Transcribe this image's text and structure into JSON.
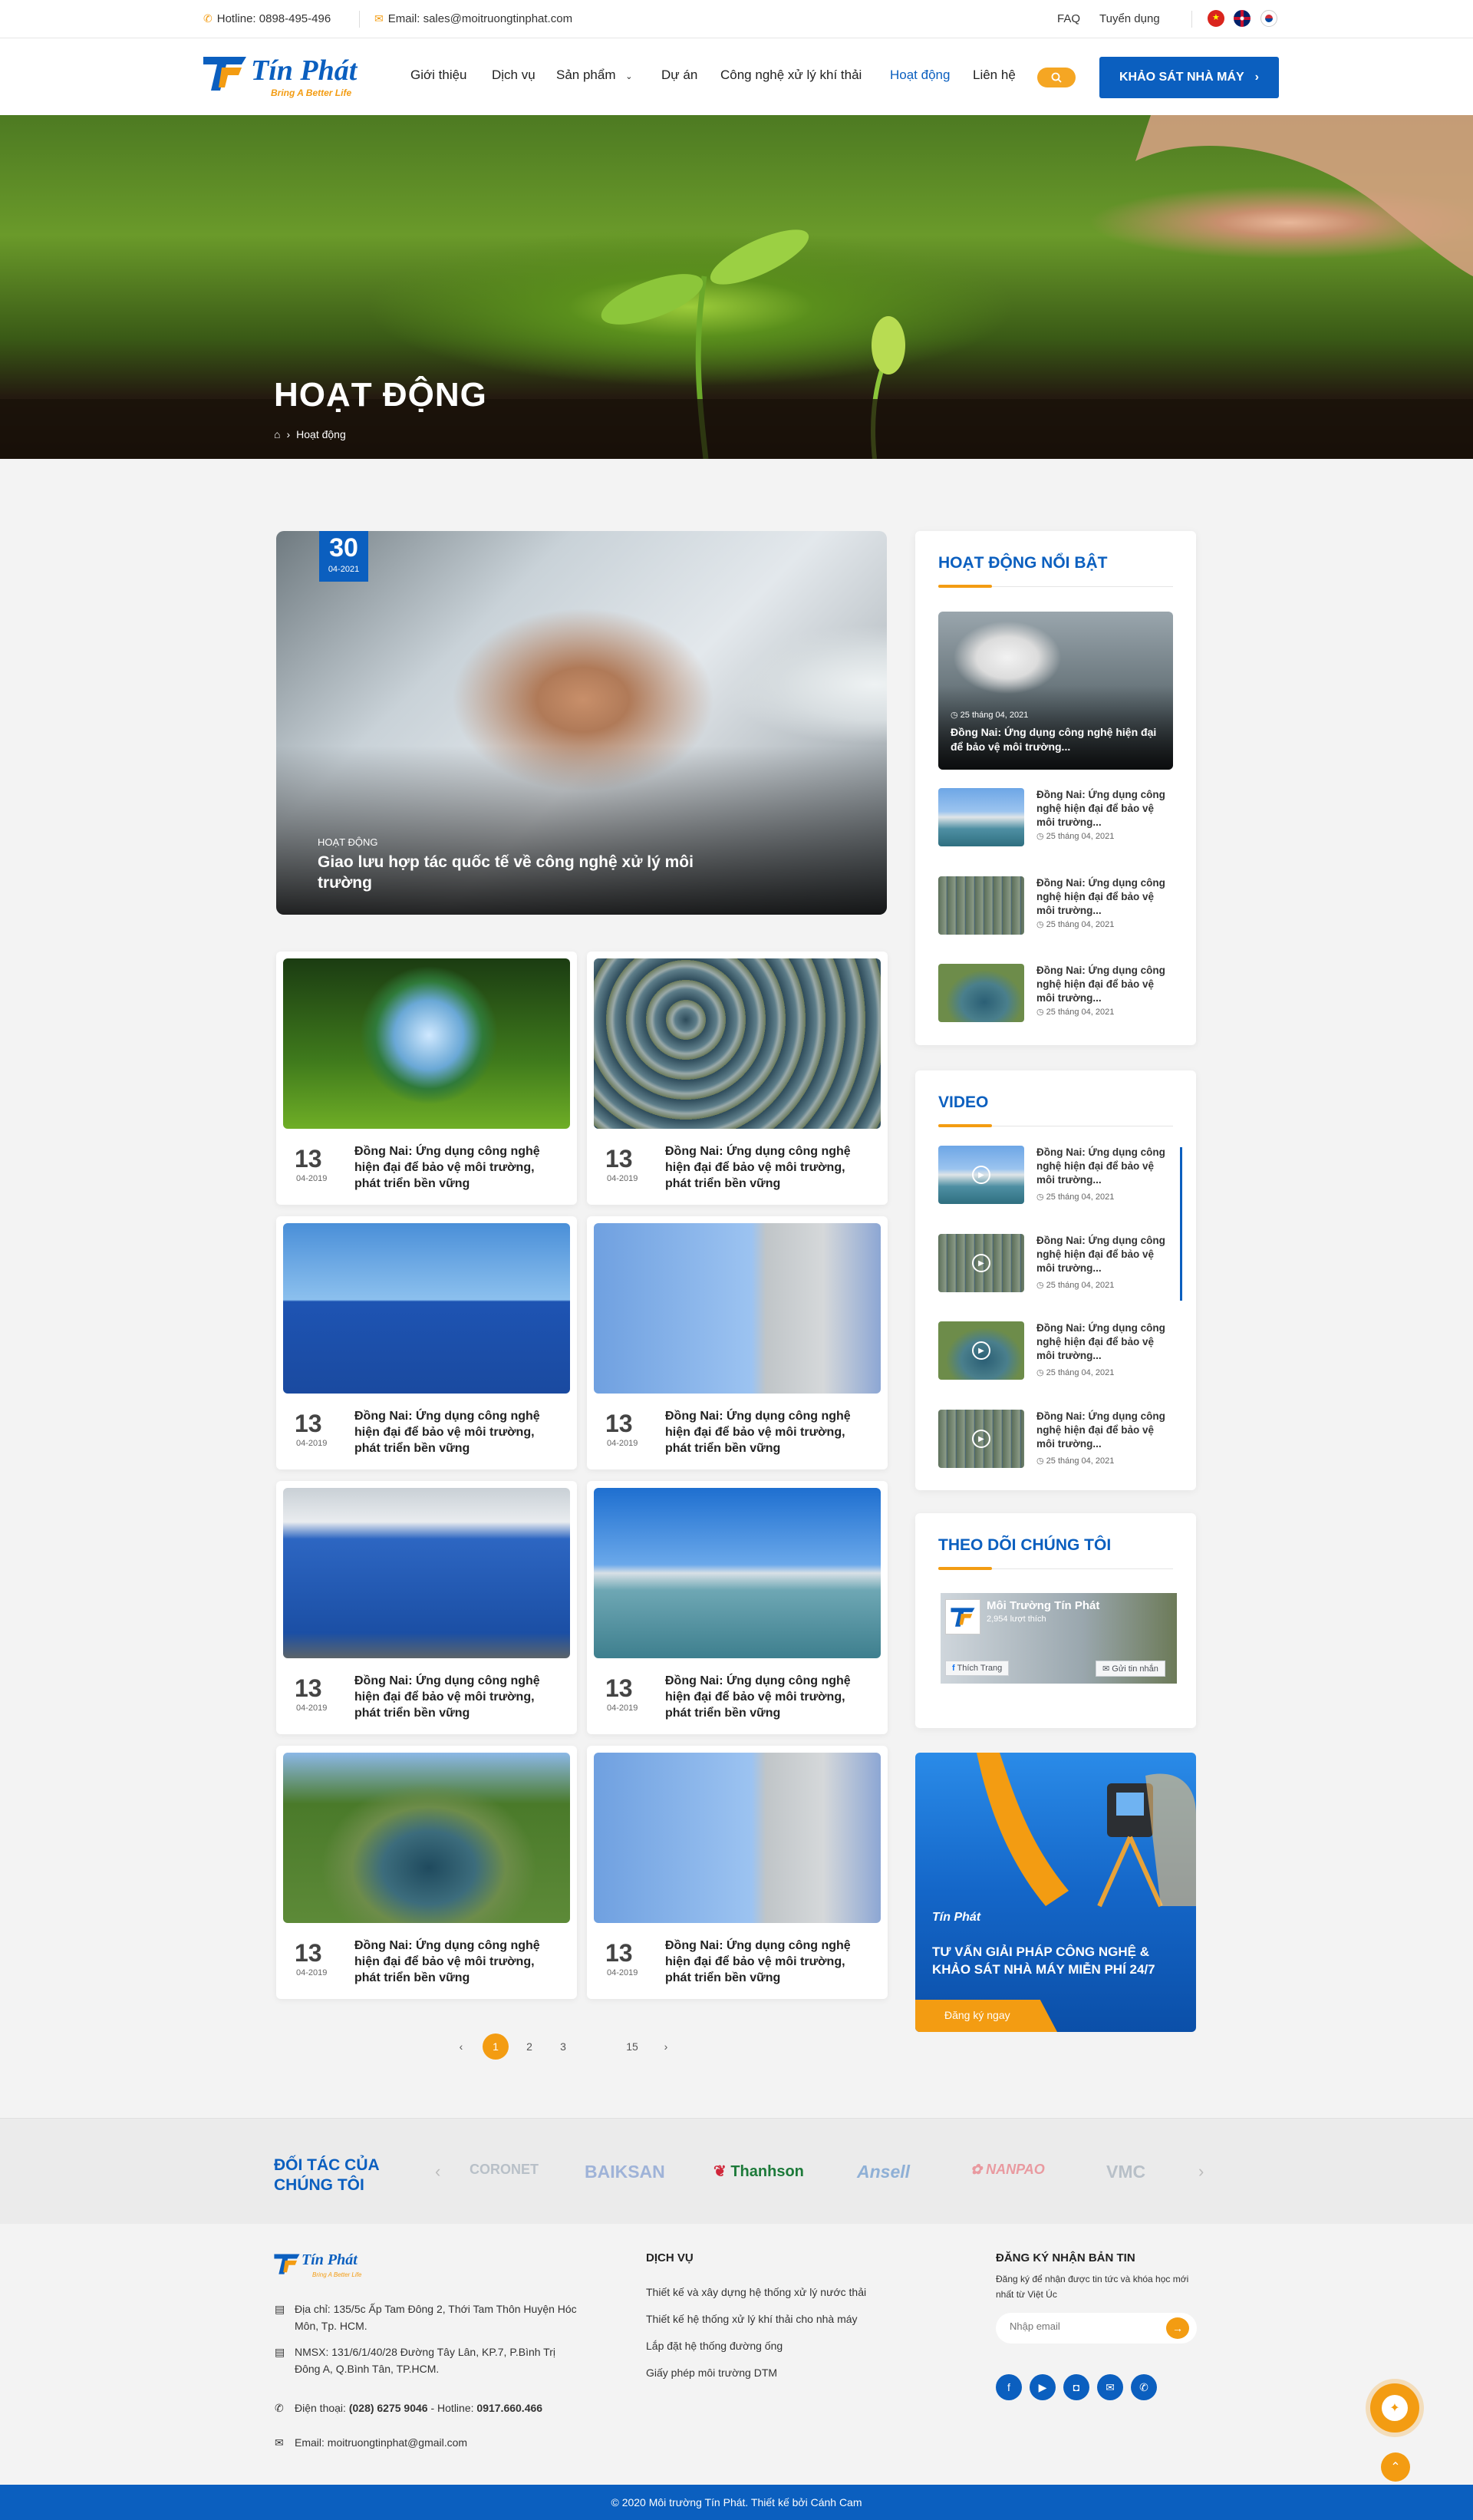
{
  "topbar": {
    "hotline": "Hotline: 0898-495-496",
    "email": "Email: sales@moitruongtinphat.com",
    "faq": "FAQ",
    "careers": "Tuyển dụng"
  },
  "brand": {
    "name": "Tín Phát",
    "tagline": "Bring A Better Life",
    "primary_color": "#0b5fbf",
    "accent_color": "#f39c12"
  },
  "nav": {
    "items": [
      "Giới thiệu",
      "Dịch vụ",
      "Sản phẩm",
      "Dự án",
      "Công nghệ xử lý khí thải",
      "Hoạt động",
      "Liên hệ"
    ],
    "active": "Hoạt động",
    "cta": "KHẢO SÁT NHÀ MÁY"
  },
  "hero": {
    "title": "HOẠT ĐỘNG",
    "breadcrumb_current": "Hoạt động"
  },
  "featured": {
    "day": "30",
    "month": "04-2021",
    "category": "HOẠT ĐỘNG",
    "title": "Giao lưu hợp tác quốc tế về công nghệ xử lý môi trường"
  },
  "articles": [
    {
      "day": "13",
      "month": "04-2019",
      "title": "Đồng Nai: Ứng dụng công nghệ hiện đại để bảo vệ môi trường, phát triển bền vững"
    },
    {
      "day": "13",
      "month": "04-2019",
      "title": "Đồng Nai: Ứng dụng công nghệ hiện đại để bảo vệ môi trường, phát triển bền vững"
    },
    {
      "day": "13",
      "month": "04-2019",
      "title": "Đồng Nai: Ứng dụng công nghệ hiện đại để bảo vệ môi trường, phát triển bền vững"
    },
    {
      "day": "13",
      "month": "04-2019",
      "title": "Đồng Nai: Ứng dụng công nghệ hiện đại để bảo vệ môi trường, phát triển bền vững"
    },
    {
      "day": "13",
      "month": "04-2019",
      "title": "Đồng Nai: Ứng dụng công nghệ hiện đại để bảo vệ môi trường, phát triển bền vững"
    },
    {
      "day": "13",
      "month": "04-2019",
      "title": "Đồng Nai: Ứng dụng công nghệ hiện đại để bảo vệ môi trường, phát triển bền vững"
    },
    {
      "day": "13",
      "month": "04-2019",
      "title": "Đồng Nai: Ứng dụng công nghệ hiện đại để bảo vệ môi trường, phát triển bền vững"
    },
    {
      "day": "13",
      "month": "04-2019",
      "title": "Đồng Nai: Ứng dụng công nghệ hiện đại để bảo vệ môi trường, phát triển bền vững"
    }
  ],
  "pagination": {
    "pages": [
      "1",
      "2",
      "3",
      "15"
    ],
    "current": "1"
  },
  "sidebar": {
    "highlight_title": "HOẠT ĐỘNG NỔI BẬT",
    "highlight_main": {
      "date": "25 tháng 04, 2021",
      "title": "Đồng Nai: Ứng dụng công nghệ hiện đại để bảo vệ môi trường..."
    },
    "highlight_items": [
      {
        "title": "Đồng Nai: Ứng dụng công nghệ hiện đại để bảo vệ môi trường...",
        "date": "25 tháng 04, 2021"
      },
      {
        "title": "Đồng Nai: Ứng dụng công nghệ hiện đại để bảo vệ môi trường...",
        "date": "25 tháng 04, 2021"
      },
      {
        "title": "Đồng Nai: Ứng dụng công nghệ hiện đại để bảo vệ môi trường...",
        "date": "25 tháng 04, 2021"
      }
    ],
    "video_title": "VIDEO",
    "videos": [
      {
        "title": "Đồng Nai: Ứng dụng công nghệ hiện đại để bảo vệ môi trường...",
        "date": "25 tháng 04, 2021"
      },
      {
        "title": "Đồng Nai: Ứng dụng công nghệ hiện đại để bảo vệ môi trường...",
        "date": "25 tháng 04, 2021"
      },
      {
        "title": "Đồng Nai: Ứng dụng công nghệ hiện đại để bảo vệ môi trường...",
        "date": "25 tháng 04, 2021"
      },
      {
        "title": "Đồng Nai: Ứng dụng công nghệ hiện đại để bảo vệ môi trường...",
        "date": "25 tháng 04, 2021"
      }
    ],
    "follow_title": "THEO DÕI CHÚNG TÔI",
    "fb_page": "Môi Trường Tín Phát",
    "fb_likes": "2,954 lượt thích",
    "fb_like_btn": "Thích Trang",
    "fb_msg_btn": "Gửi tin nhắn",
    "banner_text": "TƯ VẤN GIẢI PHÁP CÔNG NGHỆ & KHẢO SÁT NHÀ MÁY MIỄN PHÍ 24/7",
    "banner_cta": "Đăng ký ngay"
  },
  "partners": {
    "title": "ĐỐI TÁC CỦA CHÚNG TÔI",
    "logos": [
      "CORONET",
      "BAIKSAN",
      "Thanhson",
      "Ansell",
      "NANPAO",
      "VMC"
    ]
  },
  "footer": {
    "address1": "Địa chỉ: 135/5c Ấp Tam Đông 2, Thới Tam Thôn Huyện Hóc Môn, Tp. HCM.",
    "address2": "NMSX: 131/6/1/40/28 Đường Tây Lân, KP.7, P.Bình Trị Đông A, Q.Bình Tân, TP.HCM.",
    "phone_label": "Điện thoại:",
    "phone": "(028) 6275 9046",
    "hotline_label": "- Hotline:",
    "hotline": "0917.660.466",
    "email": "Email: moitruongtinphat@gmail.com",
    "services_title": "DỊCH VỤ",
    "services": [
      "Thiết kế và xây dựng hệ thống xử lý nước thải",
      "Thiết kế hệ thống xử lý khí thải cho nhà máy",
      "Lắp đặt hệ thống đường ống",
      "Giấy phép môi trường DTM"
    ],
    "newsletter_title": "ĐĂNG KÝ NHẬN BẢN TIN",
    "newsletter_desc": "Đăng ký để nhận được tin tức và khóa học mới nhất từ Việt Úc",
    "newsletter_placeholder": "Nhập email",
    "copyright": "© 2020 Môi trường Tín Phát. Thiết kế bởi Cánh Cam"
  }
}
